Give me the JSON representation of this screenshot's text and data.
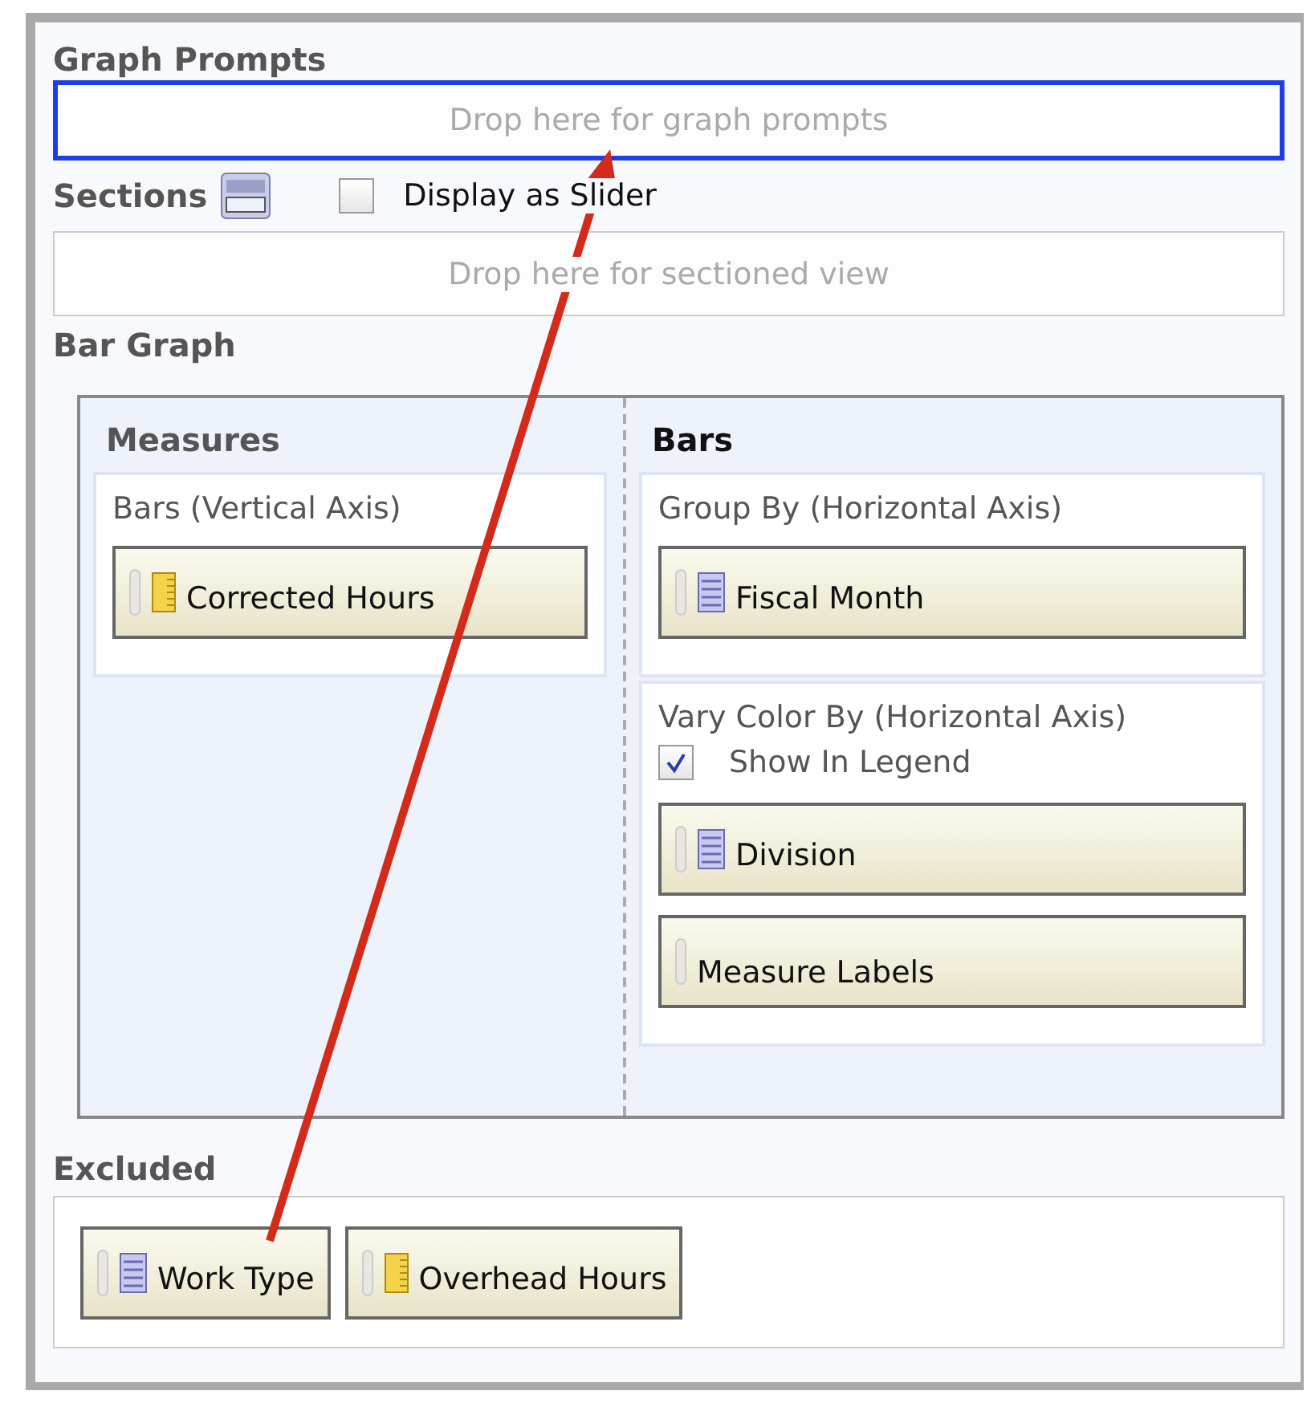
{
  "graph_prompts": {
    "heading": "Graph Prompts",
    "drop_zone": {
      "placeholder": "Drop here for graph prompts",
      "highlighted": true
    }
  },
  "sections": {
    "heading": "Sections",
    "slider_option": {
      "label": "Display as Slider",
      "checked": false
    },
    "drop_zone": {
      "placeholder": "Drop here for sectioned view",
      "highlighted": false
    }
  },
  "bar_graph": {
    "heading": "Bar Graph",
    "measures": {
      "heading": "Measures",
      "groups": [
        {
          "label": "Bars (Vertical Axis)",
          "items": [
            {
              "label": "Corrected Hours",
              "kind": "measure"
            }
          ]
        }
      ]
    },
    "bars": {
      "heading": "Bars",
      "groups": [
        {
          "label": "Group By (Horizontal Axis)",
          "items": [
            {
              "label": "Fiscal Month",
              "kind": "attribute"
            }
          ]
        },
        {
          "label": "Vary Color By (Horizontal Axis)",
          "legend_option": {
            "label": "Show In Legend",
            "checked": true
          },
          "items": [
            {
              "label": "Division",
              "kind": "attribute"
            },
            {
              "label": "Measure Labels",
              "kind": "plain"
            }
          ]
        }
      ]
    }
  },
  "excluded": {
    "heading": "Excluded",
    "items": [
      {
        "label": "Work Type",
        "kind": "attribute"
      },
      {
        "label": "Overhead Hours",
        "kind": "measure"
      }
    ]
  }
}
